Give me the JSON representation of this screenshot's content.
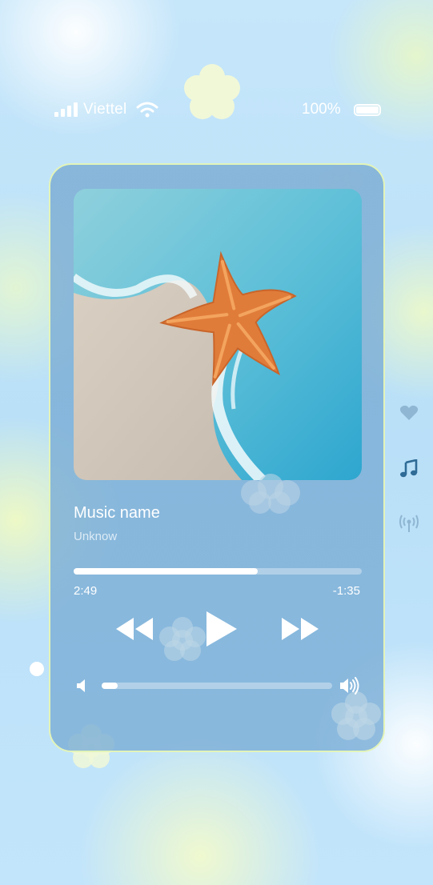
{
  "status_bar": {
    "carrier": "Viettel",
    "battery_text": "100%",
    "signal_icon": "signal-bars-icon",
    "wifi_icon": "wifi-icon",
    "battery_icon": "battery-full-icon"
  },
  "player": {
    "artwork": "starfish-on-beach-artwork",
    "song_title": "Music name",
    "artist": "Unknow",
    "progress_fraction": 0.64,
    "elapsed": "2:49",
    "remaining": "-1:35",
    "volume_fraction": 0.07,
    "controls": {
      "previous_icon": "rewind-icon",
      "play_icon": "play-icon",
      "next_icon": "fast-forward-icon",
      "volume_low_icon": "speaker-low-icon",
      "volume_high_icon": "speaker-high-icon"
    }
  },
  "side_menu": {
    "items": [
      "heart-icon",
      "music-note-icon",
      "broadcast-icon"
    ],
    "active": "music-note-icon"
  },
  "colors": {
    "card_border": "#e3f4b9",
    "accent_active": "#2f6b96",
    "text": "#ffffff"
  }
}
